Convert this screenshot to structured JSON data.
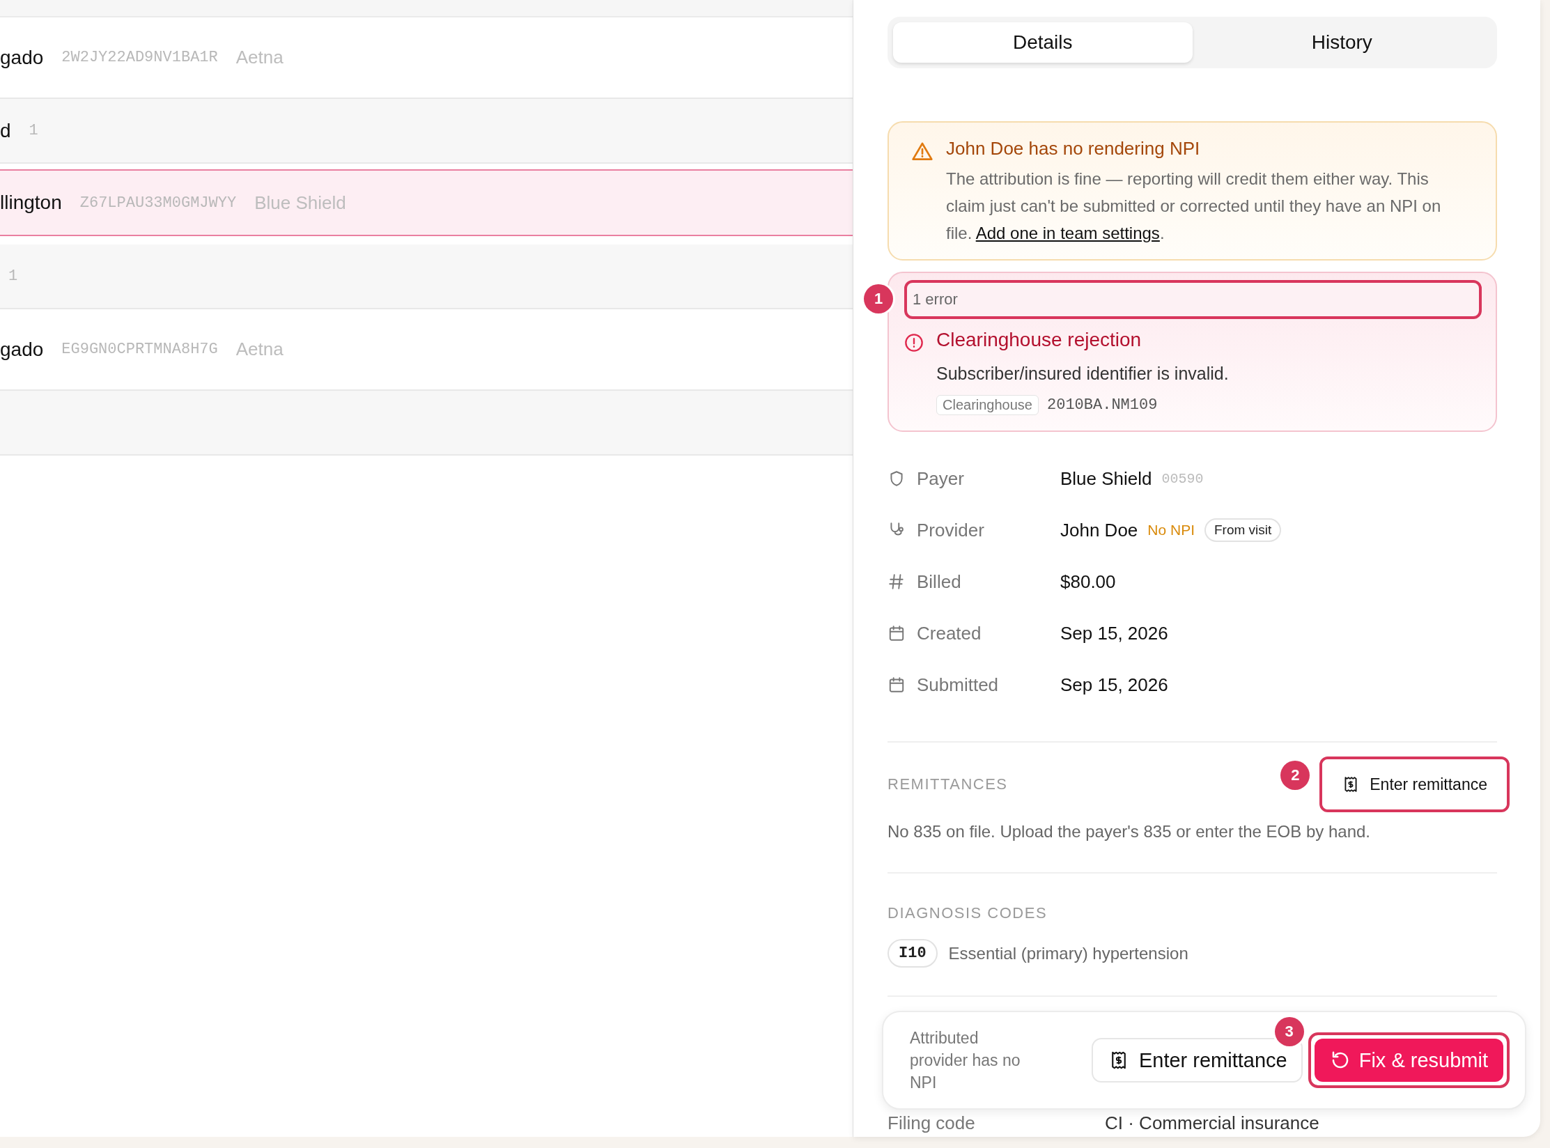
{
  "list": {
    "rows": [
      {
        "kind": "claim",
        "name": "gado",
        "code": "2W2JY22AD9NV1BA1R",
        "payer": "Aetna",
        "selected": false
      },
      {
        "kind": "group",
        "name": "d",
        "count": "1"
      },
      {
        "kind": "claim",
        "name": "llington",
        "code": "Z67LPAU33M0GMJWYY",
        "payer": "Blue Shield",
        "selected": true
      },
      {
        "kind": "group",
        "count": "1"
      },
      {
        "kind": "claim",
        "name": "gado",
        "code": "EG9GN0CPRTMNA8H7G",
        "payer": "Aetna",
        "selected": false
      },
      {
        "kind": "group"
      }
    ]
  },
  "tabs": [
    {
      "label": "Details",
      "selected": true
    },
    {
      "label": "History",
      "selected": false
    }
  ],
  "warning": {
    "title": "John Doe has no rendering NPI",
    "body": "The attribution is fine — reporting will credit them either way. This claim just can't be submitted or corrected until they have an NPI on file. ",
    "link": "Add one in team settings",
    "after": "."
  },
  "errors": {
    "count_label": "1 error",
    "marker": "1",
    "items": [
      {
        "title": "Clearinghouse rejection",
        "message": "Subscriber/insured identifier is invalid.",
        "source": "Clearinghouse",
        "segment": "2010BA.NM109"
      }
    ]
  },
  "details": [
    {
      "kind": "payer",
      "label": "Payer",
      "value": "Blue Shield",
      "code": "00590"
    },
    {
      "kind": "provider",
      "label": "Provider",
      "value": "John Doe",
      "warning": "No NPI",
      "tag": "From visit"
    },
    {
      "kind": "amount",
      "label": "Billed",
      "value": "$80.00"
    },
    {
      "kind": "date",
      "label": "Created",
      "value": "Sep 15, 2026"
    },
    {
      "kind": "date",
      "label": "Submitted",
      "value": "Sep 15, 2026"
    }
  ],
  "remittances": {
    "heading": "REMITTANCES",
    "button": "Enter remittance",
    "marker": "2",
    "note": "No 835 on file. Upload the payer's 835 or enter the EOB by hand."
  },
  "diagnosis": {
    "heading": "DIAGNOSIS CODES",
    "codes": [
      {
        "code": "I10",
        "description": "Essential (primary) hypertension"
      }
    ]
  },
  "footer": {
    "message": "Attributed provider has no NPI",
    "secondary": "Enter remittance",
    "primary": "Fix & resubmit",
    "marker": "3"
  },
  "filing": {
    "label": "Filing code",
    "value": "CI · Commercial insurance"
  }
}
